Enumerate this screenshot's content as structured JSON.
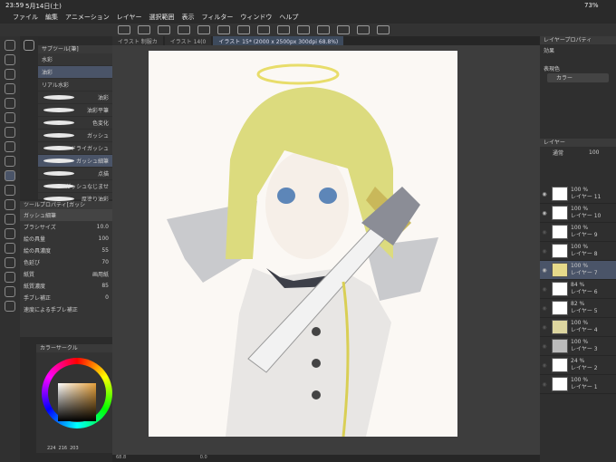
{
  "status": {
    "time": "23:59",
    "date": "5月14日(土)",
    "battery": "73%"
  },
  "menu": [
    "ファイル",
    "編集",
    "アニメーション",
    "レイヤー",
    "選択範囲",
    "表示",
    "フィルター",
    "ウィンドウ",
    "ヘルプ"
  ],
  "tabs": [
    "イラスト 制服カ",
    "イラスト 14(0",
    "イラスト 15* (2000 x 2500px 300dpi 68.8%)"
  ],
  "brushes": {
    "header": "サブツール[筆]",
    "groups": [
      "水彩",
      "油彩",
      "リアル水彩"
    ],
    "items": [
      "油彩",
      "油彩平筆",
      "色変化",
      "ガッシュ",
      "ドライガッシュ",
      "ガッシュ細筆",
      "点描",
      "ガッシュなじませ",
      "厚塗り油彩"
    ]
  },
  "toolprop": {
    "header": "ツールプロパティ[ガッシ",
    "name": "ガッシュ細筆",
    "rows": [
      {
        "label": "ブラシサイズ",
        "value": "10.0"
      },
      {
        "label": "絵の具量",
        "value": "100"
      },
      {
        "label": "絵の具濃度",
        "value": "55"
      },
      {
        "label": "色延び",
        "value": "70"
      },
      {
        "label": "紙質",
        "value": "画用紙"
      },
      {
        "label": "紙質濃度",
        "value": "85"
      },
      {
        "label": "手ブレ補正",
        "value": "0"
      },
      {
        "label": "速度による手ブレ補正",
        "value": ""
      }
    ]
  },
  "color": {
    "header": "カラーサークル",
    "r": "224",
    "g": "216",
    "b": "203"
  },
  "right": {
    "prop_header": "レイヤープロパティ",
    "effect": "効果",
    "expression": "表現色",
    "expression_value": "カラー",
    "layer_header": "レイヤー",
    "blend": "通常",
    "opacity": "100",
    "layers": [
      {
        "pct": "100 %",
        "mode": "通常",
        "name": "レイヤー 11"
      },
      {
        "pct": "100 %",
        "mode": "通常",
        "name": "レイヤー 10"
      },
      {
        "pct": "100 %",
        "mode": "乗算",
        "name": "レイヤー 9"
      },
      {
        "pct": "100 %",
        "mode": "通常",
        "name": "レイヤー 8"
      },
      {
        "pct": "100 %",
        "mode": "通常",
        "name": "レイヤー 7"
      },
      {
        "pct": "84 %",
        "mode": "通常",
        "name": "レイヤー 6"
      },
      {
        "pct": "82 %",
        "mode": "通常",
        "name": "レイヤー 5"
      },
      {
        "pct": "100 %",
        "mode": "通常",
        "name": "レイヤー 4"
      },
      {
        "pct": "100 %",
        "mode": "通常",
        "name": "レイヤー 3"
      },
      {
        "pct": "24 %",
        "mode": "通常",
        "name": "レイヤー 2"
      },
      {
        "pct": "100 %",
        "mode": "通常",
        "name": "レイヤー 1"
      }
    ]
  },
  "zoom": "68.8",
  "angle": "0.0"
}
